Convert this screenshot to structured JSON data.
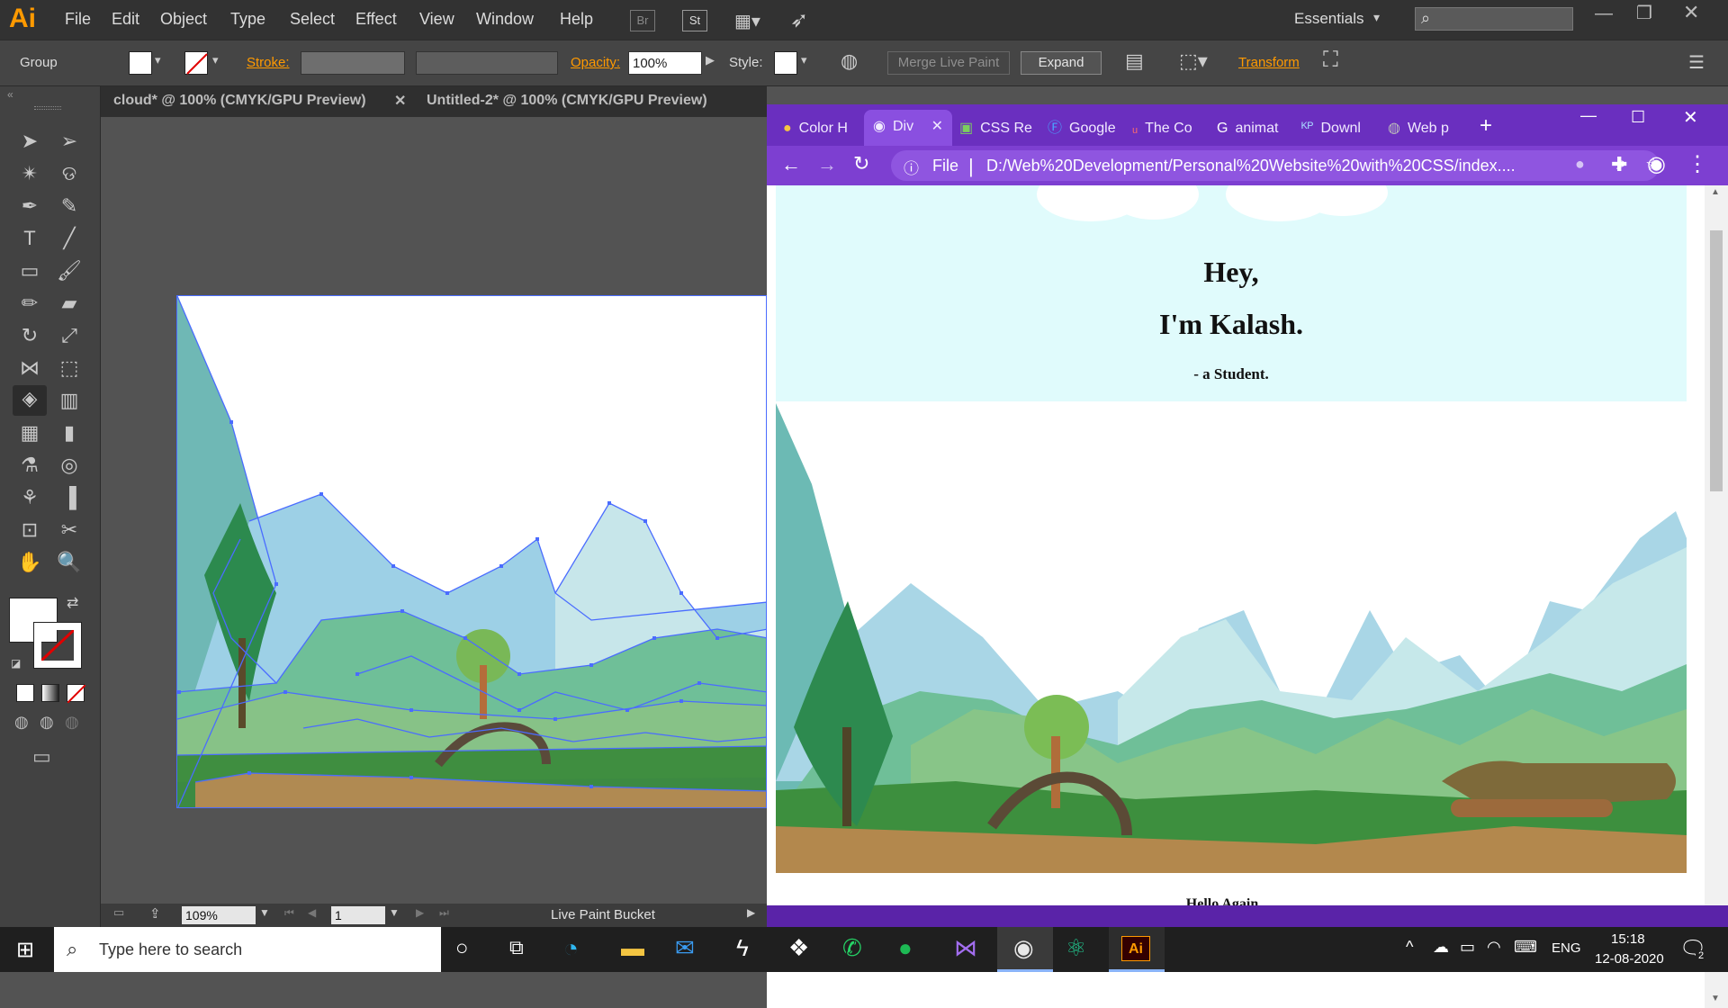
{
  "illustrator": {
    "logo": "Ai",
    "menu": [
      "File",
      "Edit",
      "Object",
      "Type",
      "Select",
      "Effect",
      "View",
      "Window",
      "Help"
    ],
    "bridge_label": "Br",
    "stock_label": "St",
    "workspace": "Essentials",
    "control": {
      "selection_label": "Group",
      "stroke_label": "Stroke:",
      "opacity_label": "Opacity:",
      "opacity_value": "100%",
      "style_label": "Style:",
      "merge_button": "Merge Live Paint",
      "expand_button": "Expand",
      "transform_label": "Transform"
    },
    "doc_tabs": [
      {
        "label": "cloud* @ 100% (CMYK/GPU Preview)"
      },
      {
        "label": "Untitled-2* @ 100% (CMYK/GPU Preview)"
      }
    ],
    "status": {
      "zoom": "109%",
      "artboard": "1",
      "tool_name": "Live Paint Bucket"
    }
  },
  "browser": {
    "tabs": [
      {
        "label": "Color H"
      },
      {
        "label": "Div"
      },
      {
        "label": "CSS Re"
      },
      {
        "label": "Google"
      },
      {
        "label": "The Co"
      },
      {
        "label": "animat"
      },
      {
        "label": "Downl"
      },
      {
        "label": "Web p"
      }
    ],
    "new_tab_symbol": "+",
    "url_scheme": "File",
    "url": "D:/Web%20Development/Personal%20Website%20with%20CSS/index....",
    "page": {
      "greeting": "Hey,",
      "name": "I'm Kalash.",
      "tagline": "- a Student.",
      "below_text": "Hello Again"
    }
  },
  "taskbar": {
    "search_placeholder": "Type here to search",
    "language": "ENG",
    "time": "15:18",
    "date": "12-08-2020",
    "notification_count": "2"
  },
  "colors": {
    "ai_orange": "#ff9a00",
    "chrome_purple": "#6a2fbf",
    "sky_cyan": "#e0fbfc",
    "path_blue": "#4a6cff"
  }
}
